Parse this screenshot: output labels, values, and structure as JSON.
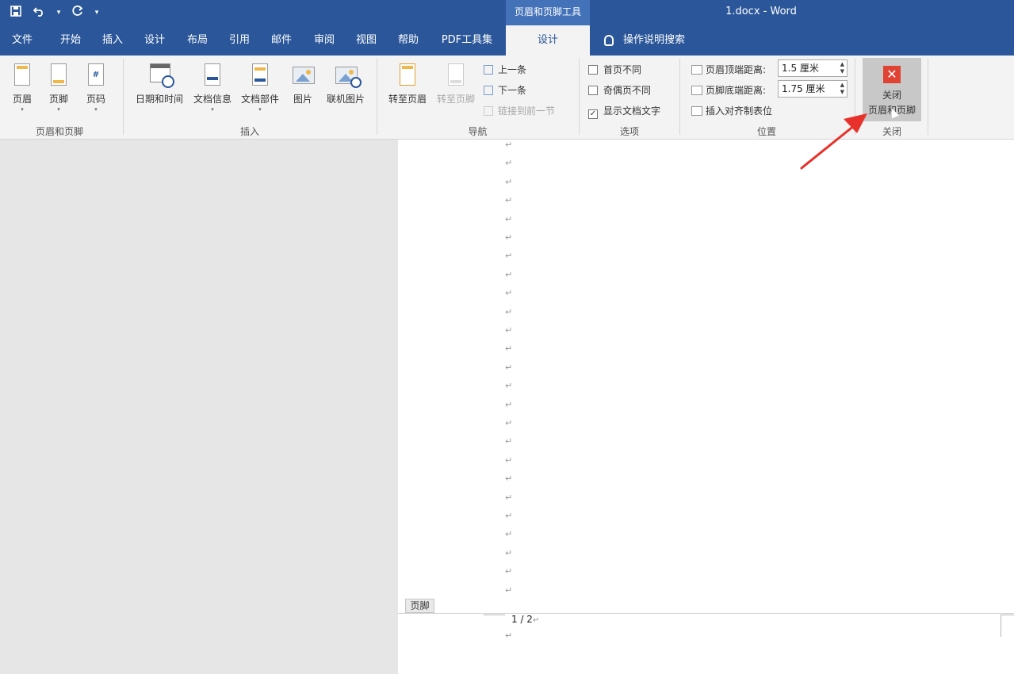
{
  "window": {
    "doc_title": "1.docx  -  Word",
    "context_tab_group": "页眉和页脚工具"
  },
  "qat": {
    "save_icon": "save-icon",
    "undo_icon": "undo-icon",
    "redo_icon": "redo-icon"
  },
  "tabs": [
    {
      "label": "文件"
    },
    {
      "label": "开始"
    },
    {
      "label": "插入"
    },
    {
      "label": "设计"
    },
    {
      "label": "布局"
    },
    {
      "label": "引用"
    },
    {
      "label": "邮件"
    },
    {
      "label": "审阅"
    },
    {
      "label": "视图"
    },
    {
      "label": "帮助"
    },
    {
      "label": "PDF工具集"
    },
    {
      "label": "设计",
      "active": true
    }
  ],
  "tell_me": "操作说明搜索",
  "ribbon": {
    "group_hf": {
      "label": "页眉和页脚",
      "header": "页眉",
      "footer": "页脚",
      "page_number": "页码"
    },
    "group_insert": {
      "label": "插入",
      "datetime": "日期和时间",
      "docinfo": "文档信息",
      "quickparts": "文档部件",
      "picture": "图片",
      "online_picture": "联机图片"
    },
    "group_nav": {
      "label": "导航",
      "goto_header": "转至页眉",
      "goto_footer": "转至页脚",
      "previous": "上一条",
      "next": "下一条",
      "link_previous": "链接到前一节"
    },
    "group_options": {
      "label": "选项",
      "diff_first": "首页不同",
      "diff_odd_even": "奇偶页不同",
      "show_doc_text": "显示文档文字",
      "show_doc_text_check": "✓"
    },
    "group_position": {
      "label": "位置",
      "header_top": "页眉顶端距离:",
      "header_top_value": "1.5 厘米",
      "footer_bottom": "页脚底端距离:",
      "footer_bottom_value": "1.75 厘米",
      "insert_tab": "插入对齐制表位"
    },
    "group_close": {
      "label": "关闭",
      "close_line1": "关闭",
      "close_line2": "页眉和页脚",
      "close_icon": "✕"
    }
  },
  "document": {
    "para_mark": "↵",
    "footer_tag": "页脚",
    "page_number_text": "1 / 2"
  },
  "colors": {
    "brand": "#2b579a",
    "annotation_arrow": "#e8312b",
    "close_icon": "#e04334"
  }
}
